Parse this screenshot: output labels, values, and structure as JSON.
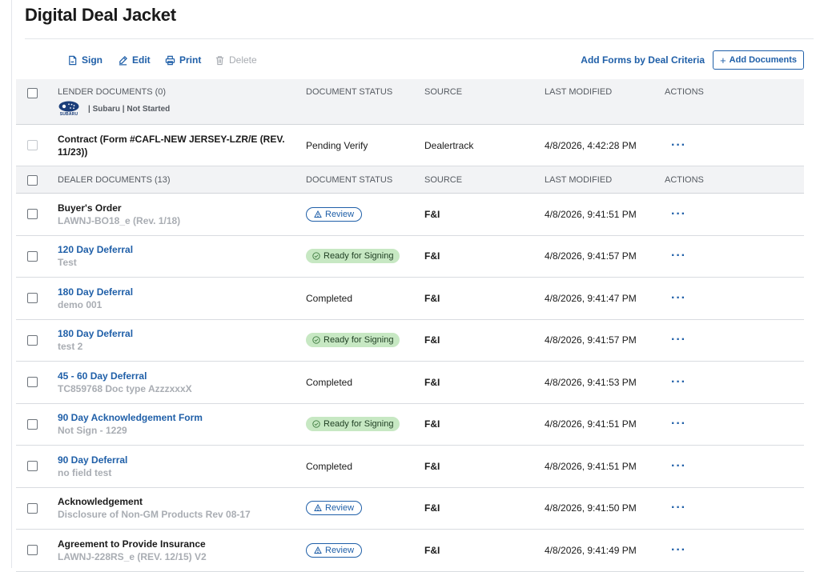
{
  "page": {
    "title": "Digital Deal Jacket"
  },
  "toolbar": {
    "sign": "Sign",
    "edit": "Edit",
    "print": "Print",
    "delete": "Delete",
    "add_by_criteria": "Add Forms by Deal Criteria",
    "add_documents": "Add Documents",
    "add_documents_icon": "+"
  },
  "lender": {
    "header": {
      "section": "LENDER DOCUMENTS (0)",
      "status": "DOCUMENT STATUS",
      "source": "SOURCE",
      "modified": "LAST MODIFIED",
      "actions": "ACTIONS"
    },
    "logo_text": "SUBARU",
    "brand_info": "| Subaru | Not Started",
    "rows": [
      {
        "title": "Contract (Form #CAFL-NEW JERSEY-LZR/E (REV. 11/23))",
        "status": "Pending Verify",
        "source": "Dealertrack",
        "modified": "4/8/2026, 4:42:28 PM",
        "actions": "···"
      }
    ]
  },
  "dealer": {
    "header": {
      "section": "DEALER DOCUMENTS (13)",
      "status": "DOCUMENT STATUS",
      "source": "SOURCE",
      "modified": "LAST MODIFIED",
      "actions": "ACTIONS"
    },
    "rows": [
      {
        "title": "Buyer's Order",
        "subtitle": "LAWNJ-BO18_e (Rev. 1/18)",
        "status": "Review",
        "source": "F&I",
        "modified": "4/8/2026, 9:41:51 PM",
        "actions": "···"
      },
      {
        "title": "120 Day Deferral",
        "subtitle": "Test",
        "status": "Ready for Signing",
        "source": "F&I",
        "modified": "4/8/2026, 9:41:57 PM",
        "actions": "···"
      },
      {
        "title": "180 Day Deferral",
        "subtitle": "demo 001",
        "status": "Completed",
        "source": "F&I",
        "modified": "4/8/2026, 9:41:47 PM",
        "actions": "···"
      },
      {
        "title": "180 Day Deferral",
        "subtitle": "test 2",
        "status": "Ready for Signing",
        "source": "F&I",
        "modified": "4/8/2026, 9:41:57 PM",
        "actions": "···"
      },
      {
        "title": "45 - 60 Day Deferral",
        "subtitle": "TC859768 Doc type AzzzxxxX",
        "status": "Completed",
        "source": "F&I",
        "modified": "4/8/2026, 9:41:53 PM",
        "actions": "···"
      },
      {
        "title": "90 Day Acknowledgement Form",
        "subtitle": "Not Sign - 1229",
        "status": "Ready for Signing",
        "source": "F&I",
        "modified": "4/8/2026, 9:41:51 PM",
        "actions": "···"
      },
      {
        "title": "90 Day Deferral",
        "subtitle": "no field test",
        "status": "Completed",
        "source": "F&I",
        "modified": "4/8/2026, 9:41:51 PM",
        "actions": "···"
      },
      {
        "title": "Acknowledgement",
        "subtitle": "Disclosure of Non-GM Products Rev 08-17",
        "status": "Review",
        "source": "F&I",
        "modified": "4/8/2026, 9:41:50 PM",
        "actions": "···"
      },
      {
        "title": "Agreement to Provide Insurance",
        "subtitle": "LAWNJ-228RS_e (REV. 12/15) V2",
        "status": "Review",
        "source": "F&I",
        "modified": "4/8/2026, 9:41:49 PM",
        "actions": "···"
      }
    ]
  },
  "colors": {
    "link": "#1f5fa8",
    "ready_bg": "#c7e8c3",
    "header_bg": "#f2f3f5",
    "subtitle": "#a9adb3"
  },
  "icons": {
    "sign": "sign-document-icon",
    "edit": "pencil-icon",
    "print": "printer-icon",
    "delete": "trash-icon",
    "review": "warning-triangle-icon",
    "ready": "check-circle-icon",
    "actions": "more-horizontal-icon",
    "logo": "subaru-logo"
  }
}
